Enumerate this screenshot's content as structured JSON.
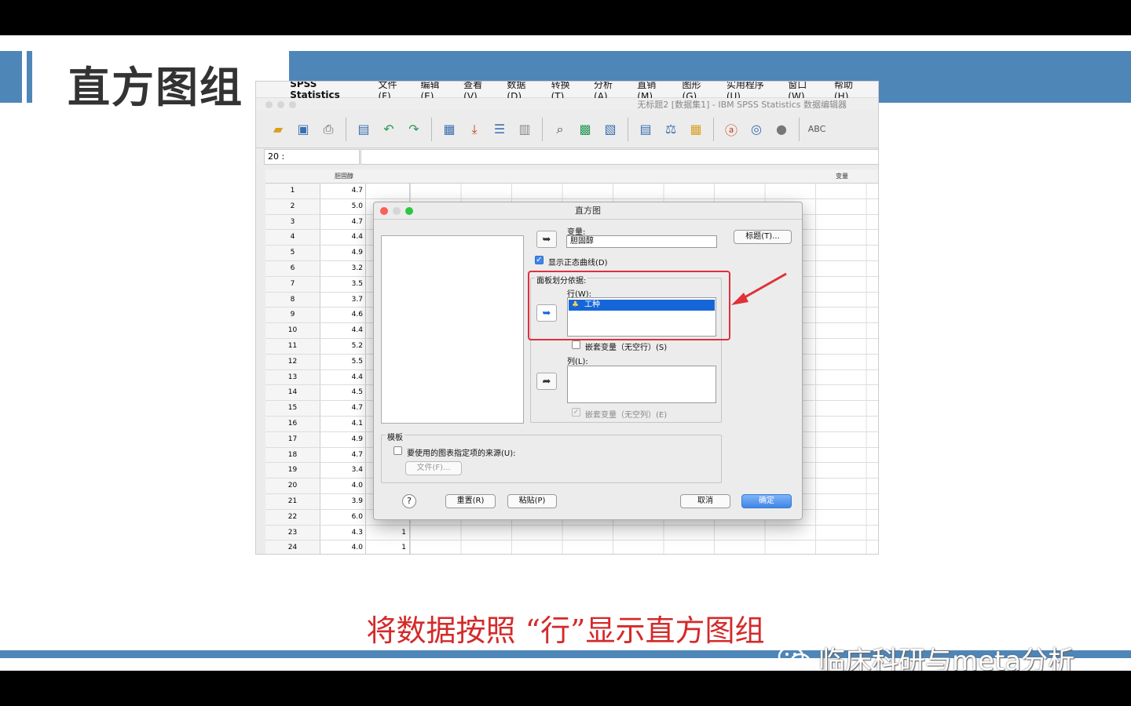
{
  "slide": {
    "title": "直方图组",
    "caption": "将数据按照 “行”显示直方图组",
    "watermark": "临床科研与meta分析"
  },
  "menubar": {
    "app": "SPSS Statistics",
    "items": [
      "文件(F)",
      "编辑(E)",
      "查看(V)",
      "数据(D)",
      "转换(T)",
      "分析(A)",
      "直销(M)",
      "图形(G)",
      "实用程序(U)",
      "窗口(W)",
      "帮助(H)"
    ]
  },
  "window": {
    "title": "无标题2 [数据集1] - IBM SPSS Statistics 数据编辑器"
  },
  "editor": {
    "cell_ref": "20 :",
    "col1_header": "胆固醇",
    "last_col_header": "变量",
    "rows": [
      {
        "n": "1",
        "v": "4.7",
        "g": ""
      },
      {
        "n": "2",
        "v": "5.0",
        "g": ""
      },
      {
        "n": "3",
        "v": "4.7",
        "g": ""
      },
      {
        "n": "4",
        "v": "4.4",
        "g": ""
      },
      {
        "n": "5",
        "v": "4.9",
        "g": ""
      },
      {
        "n": "6",
        "v": "3.2",
        "g": ""
      },
      {
        "n": "7",
        "v": "3.5",
        "g": ""
      },
      {
        "n": "8",
        "v": "3.7",
        "g": ""
      },
      {
        "n": "9",
        "v": "4.6",
        "g": ""
      },
      {
        "n": "10",
        "v": "4.4",
        "g": ""
      },
      {
        "n": "11",
        "v": "5.2",
        "g": ""
      },
      {
        "n": "12",
        "v": "5.5",
        "g": ""
      },
      {
        "n": "13",
        "v": "4.4",
        "g": ""
      },
      {
        "n": "14",
        "v": "4.5",
        "g": ""
      },
      {
        "n": "15",
        "v": "4.7",
        "g": ""
      },
      {
        "n": "16",
        "v": "4.1",
        "g": ""
      },
      {
        "n": "17",
        "v": "4.9",
        "g": ""
      },
      {
        "n": "18",
        "v": "4.7",
        "g": ""
      },
      {
        "n": "19",
        "v": "3.4",
        "g": ""
      },
      {
        "n": "20",
        "v": "4.0",
        "g": ""
      },
      {
        "n": "21",
        "v": "3.9",
        "g": "1"
      },
      {
        "n": "22",
        "v": "6.0",
        "g": "1"
      },
      {
        "n": "23",
        "v": "4.3",
        "g": "1"
      },
      {
        "n": "24",
        "v": "4.0",
        "g": "1"
      }
    ]
  },
  "dialog": {
    "title": "直方图",
    "variable_label": "变量:",
    "variable_value": "胆固醇",
    "titles_button": "标题(T)...",
    "normal_curve_label": "显示正态曲线(D)",
    "panel_group_label": "面板划分依据:",
    "rows_label": "行(W):",
    "rows_value": "工种",
    "nest_rows_label": "嵌套变量（无空行）(S)",
    "cols_label": "列(L):",
    "nest_cols_label": "嵌套变量（无空列）(E)",
    "template_group_label": "模板",
    "template_check_label": "要使用的图表指定项的来源(U):",
    "file_button": "文件(F)...",
    "help_button": "?",
    "reset_button": "重置(R)",
    "paste_button": "粘贴(P)",
    "cancel_button": "取消",
    "ok_button": "确定"
  },
  "colors": {
    "accent_blue": "#4f86b8",
    "caption_red": "#d42a2a",
    "highlight_red": "#e0303a"
  }
}
